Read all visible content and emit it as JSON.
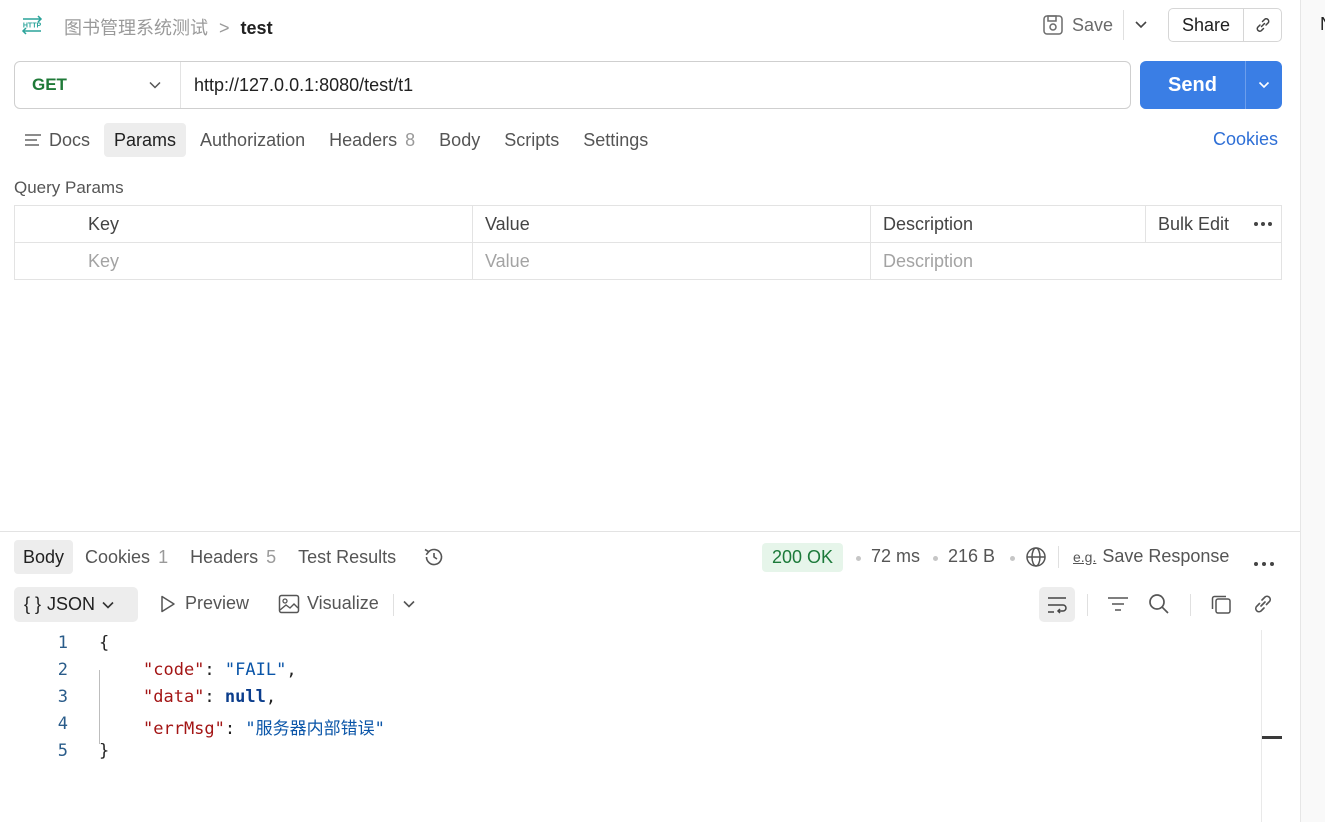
{
  "header": {
    "http_badge": "HTTP",
    "collection": "图书管理系统测试",
    "separator": ">",
    "request_name": "test",
    "save_label": "Save",
    "share_label": "Share"
  },
  "request": {
    "method": "GET",
    "url": "http://127.0.0.1:8080/test/t1",
    "send_label": "Send",
    "method_color": "#1f7a38",
    "send_color": "#3a7ee5"
  },
  "request_tabs": {
    "docs": "Docs",
    "params": "Params",
    "authorization": "Authorization",
    "headers": "Headers",
    "headers_count": "8",
    "body": "Body",
    "scripts": "Scripts",
    "settings": "Settings",
    "active": "Params"
  },
  "cookies_link": "Cookies",
  "query_params": {
    "title": "Query Params",
    "columns": [
      "Key",
      "Value",
      "Description"
    ],
    "bulk_edit": "Bulk Edit",
    "placeholders": {
      "key": "Key",
      "value": "Value",
      "description": "Description"
    }
  },
  "response_tabs": {
    "body": "Body",
    "cookies": "Cookies",
    "cookies_count": "1",
    "headers": "Headers",
    "headers_count": "5",
    "test_results": "Test Results",
    "active": "Body"
  },
  "response_meta": {
    "status": "200 OK",
    "time": "72 ms",
    "size": "216 B",
    "save_response": "Save Response",
    "eg_label": "e.g."
  },
  "response_toolbar": {
    "format": "JSON",
    "format_prefix": "{ }",
    "preview": "Preview",
    "visualize": "Visualize"
  },
  "response_body": {
    "line_numbers": [
      "1",
      "2",
      "3",
      "4",
      "5"
    ],
    "open_brace": "{",
    "close_brace": "}",
    "fields": [
      {
        "key": "\"code\"",
        "value": "\"FAIL\"",
        "trail": ","
      },
      {
        "key": "\"data\"",
        "value": "null",
        "trail": ","
      },
      {
        "key": "\"errMsg\"",
        "value": "\"服务器内部错误\"",
        "trail": ""
      }
    ]
  },
  "right_strip_letter": "N"
}
